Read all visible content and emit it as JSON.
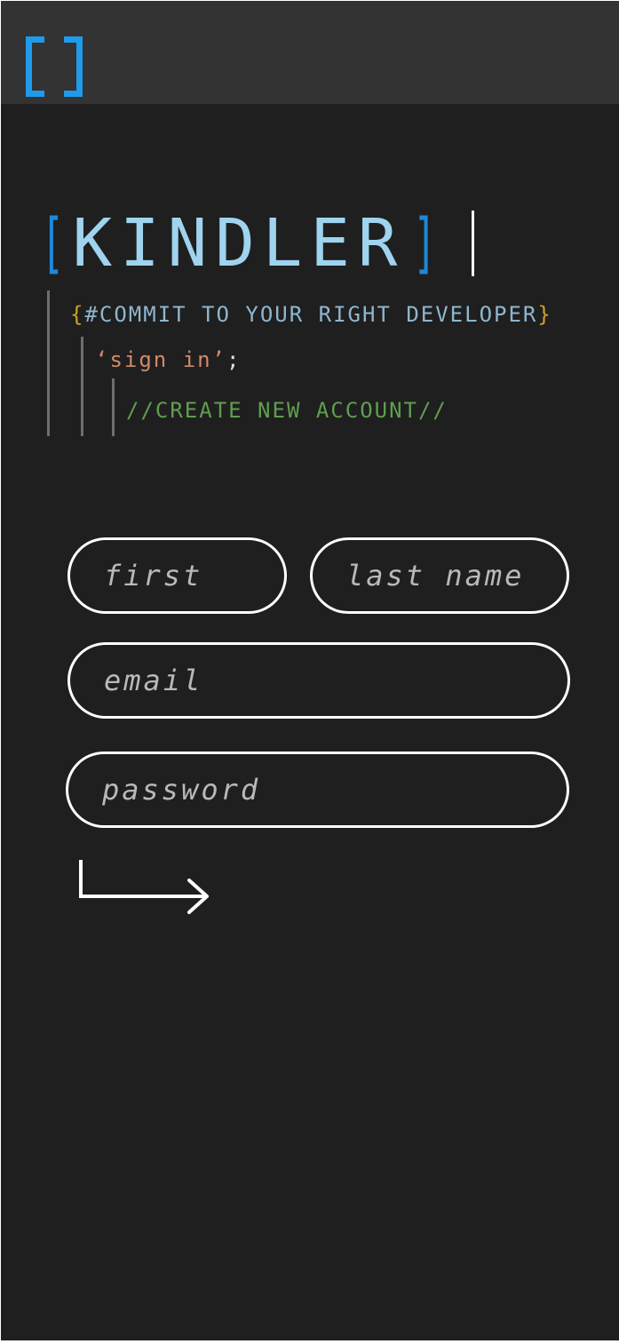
{
  "header": {
    "logo_icon": "bracket-logo-icon",
    "brand_color": "#1e9bea"
  },
  "hero": {
    "open_bracket": "[",
    "title": "KINDLER",
    "close_bracket": "]"
  },
  "code_lines": {
    "tagline_open": "{",
    "tagline": "#COMMIT TO YOUR RIGHT DEVELOPER",
    "tagline_close": "}",
    "sign_in": "‘sign in’",
    "sign_in_end": ";",
    "create_account": "//CREATE NEW ACCOUNT//"
  },
  "form": {
    "first_placeholder": "first",
    "last_placeholder": "last name",
    "email_placeholder": "email",
    "password_placeholder": "password",
    "submit_icon": "enter-arrow-icon"
  },
  "colors": {
    "background": "#1f1f1f",
    "topbar": "#333333",
    "title": "#9fd3ee",
    "bracket": "#1e88d9",
    "tagline": "#8fb6cf",
    "curly": "#c9a227",
    "string": "#d08a6a",
    "comment": "#5f9e4f"
  }
}
